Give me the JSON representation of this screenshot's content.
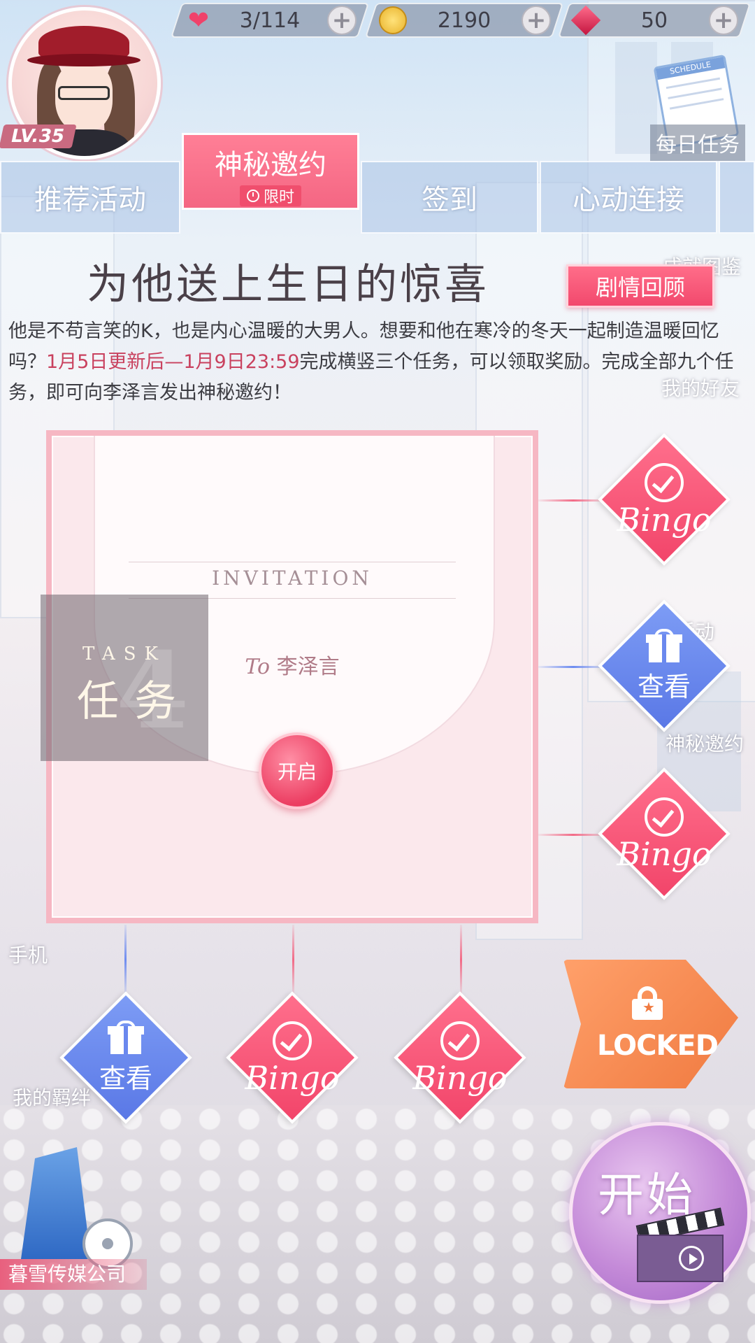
{
  "top_bar": {
    "stamina": {
      "value": "3/114",
      "icon": "heart-icon"
    },
    "coins": {
      "value": "2190",
      "icon": "coin-icon"
    },
    "diamonds": {
      "value": "50",
      "icon": "gem-icon"
    },
    "plus_label": "+"
  },
  "player": {
    "level": "LV.35"
  },
  "daily_task": {
    "label": "每日任务",
    "card_header": "SCHEDULE"
  },
  "tabs": {
    "recommend": "推荐活动",
    "secret_invite": "神秘邀约",
    "limited": "限时",
    "sign_in": "签到",
    "heart_link": "心动连接"
  },
  "event": {
    "title": "为他送上生日的惊喜",
    "recap_button": "剧情回顾",
    "desc_part1": "他是不苟言笑的K，也是内心温暖的大男人。想要和他在寒冷的冬天一起制造温暖回忆吗？",
    "desc_highlight": "1月5日更新后—1月9日23:59",
    "desc_part2": "完成横竖三个任务，可以领取奖励。完成全部九个任务，即可向李泽言发出神秘邀约！"
  },
  "invitation": {
    "heading": "INVITATION",
    "to_prefix": "To",
    "to_name": "李泽言",
    "open_button": "开启"
  },
  "task": {
    "en": "TASK",
    "zh": "任务",
    "number": "4"
  },
  "rewards": {
    "bingo_label": "Bingo",
    "view_label": "查看",
    "locked_label": "LOCKED"
  },
  "start_button": "开始",
  "background_labels": {
    "album": "成就图鉴",
    "friends": "我的好友",
    "mystery": "神秘邀约",
    "phone": "手机",
    "bonds": "我的羁绊",
    "company": "暮雪传媒公司",
    "activity": "活动"
  },
  "colors": {
    "accent_pink": "#f2456a",
    "accent_blue": "#5a78e6",
    "locked_orange": "#f07a40"
  }
}
